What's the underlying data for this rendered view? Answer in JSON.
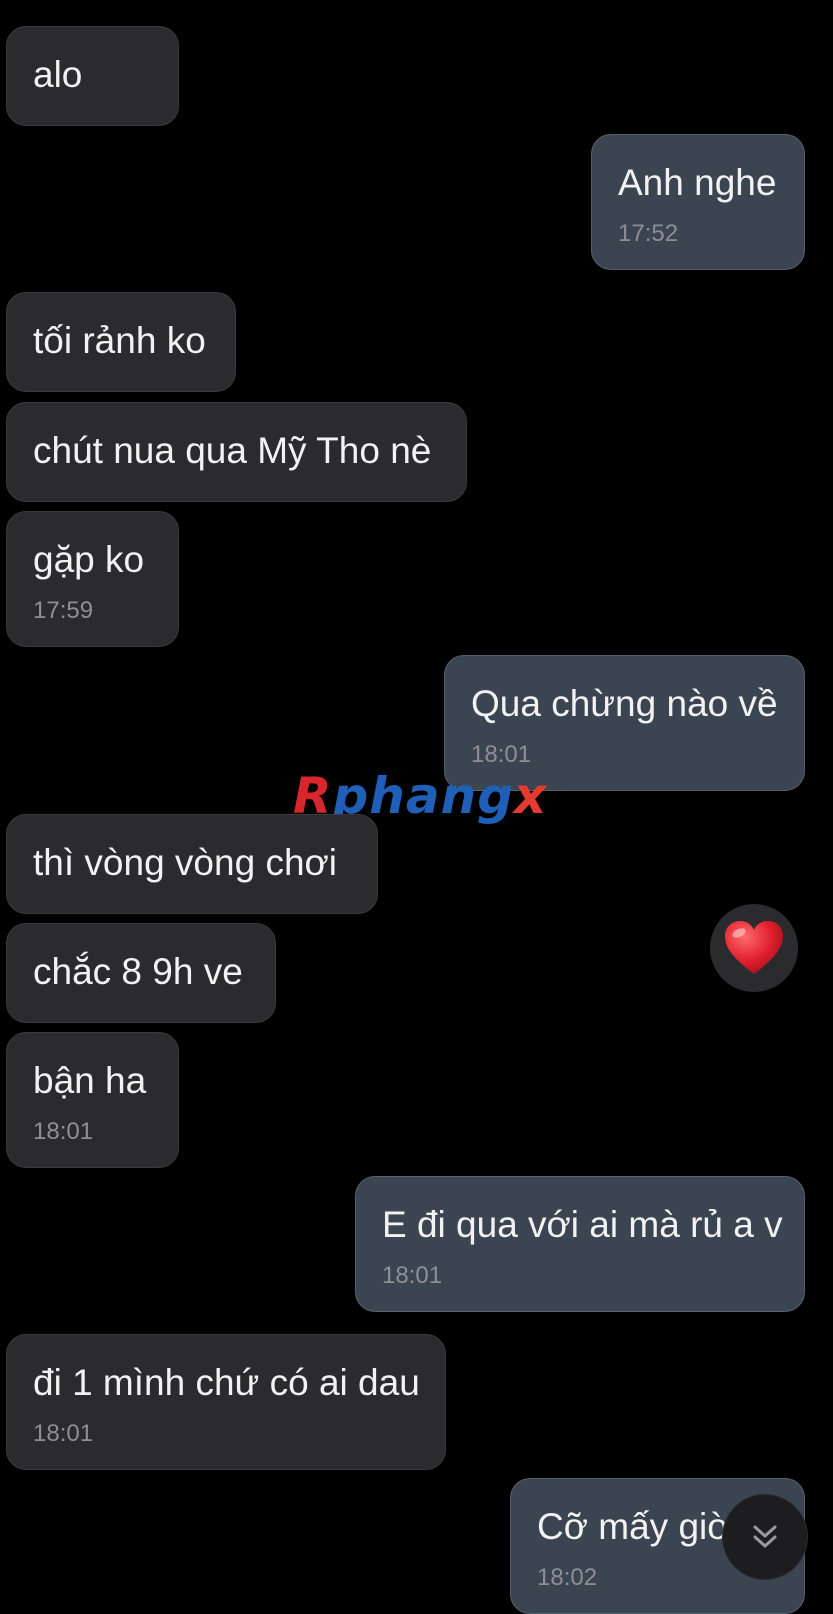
{
  "messages": [
    {
      "dir": "received",
      "text": "alo",
      "time": ""
    },
    {
      "dir": "sent",
      "text": "Anh nghe",
      "time": "17:52"
    },
    {
      "dir": "received",
      "text": "tối rảnh ko",
      "time": ""
    },
    {
      "dir": "received",
      "text": "chút nua qua Mỹ Tho nè",
      "time": ""
    },
    {
      "dir": "received",
      "text": "gặp ko",
      "time": "17:59"
    },
    {
      "dir": "sent",
      "text": "Qua chừng nào về",
      "time": "18:01"
    },
    {
      "dir": "received",
      "text": "thì vòng vòng chơi",
      "time": ""
    },
    {
      "dir": "received",
      "text": "chắc 8 9h ve",
      "time": ""
    },
    {
      "dir": "received",
      "text": "bận ha",
      "time": "18:01"
    },
    {
      "dir": "sent",
      "text": "E đi qua với ai mà rủ a v",
      "time": "18:01"
    },
    {
      "dir": "received",
      "text": "đi 1 mình chứ có ai dau",
      "time": "18:01"
    },
    {
      "dir": "sent",
      "text": "Cỡ mấy giờ",
      "time": "18:02"
    }
  ],
  "watermark": {
    "r": "R",
    "mid": "phang",
    "x": "x"
  },
  "reaction": {
    "icon": "heart-icon",
    "color": "#e0202e"
  },
  "scroll_button": {
    "icon": "double-chevron-down-icon"
  },
  "colors": {
    "background": "#000000",
    "received_bubble": "#2b2b2d",
    "sent_bubble": "#3b4552",
    "timestamp": "#8e8e93",
    "text": "#f2f2f2"
  }
}
